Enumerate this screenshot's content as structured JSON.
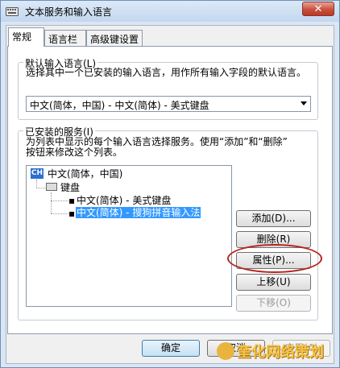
{
  "window": {
    "title": "文本服务和输入语言",
    "close_label": "✕"
  },
  "tabs": [
    {
      "label": "常规",
      "active": true
    },
    {
      "label": "语言栏",
      "active": false
    },
    {
      "label": "高级键设置",
      "active": false
    }
  ],
  "default_language": {
    "group_title": "默认输入语言(L)",
    "description": "选择其中一个已安装的输入语言，用作所有输入字段的默认语言。",
    "selected_value": "中文(简体，中国) - 中文(简体) - 美式键盘"
  },
  "installed_services": {
    "group_title": "已安装的服务(I)",
    "description_line1": "为列表中显示的每个输入语言选择服务。使用“添加”和“删除”",
    "description_line2": "按钮来修改这个列表。",
    "tree": {
      "language_badge": "CH",
      "language": "中文(简体，中国)",
      "category": "键盘",
      "items": [
        {
          "label": "中文(简体) - 美式键盘",
          "selected": false
        },
        {
          "label": "中文(简体) - 搜狗拼音输入法",
          "selected": true
        }
      ]
    },
    "buttons": {
      "add": "添加(D)...",
      "remove": "删除(R)",
      "properties": "属性(P)...",
      "move_up": "上移(U)",
      "move_down": "下移(O)"
    }
  },
  "footer": {
    "ok": "确定",
    "cancel": "取消",
    "apply": "应用(A)"
  },
  "watermark": {
    "text": "奎化网络策划"
  },
  "colors": {
    "selection": "#3399ff",
    "annotation_ellipse": "#b5251d",
    "close_button": "#c9503c"
  }
}
